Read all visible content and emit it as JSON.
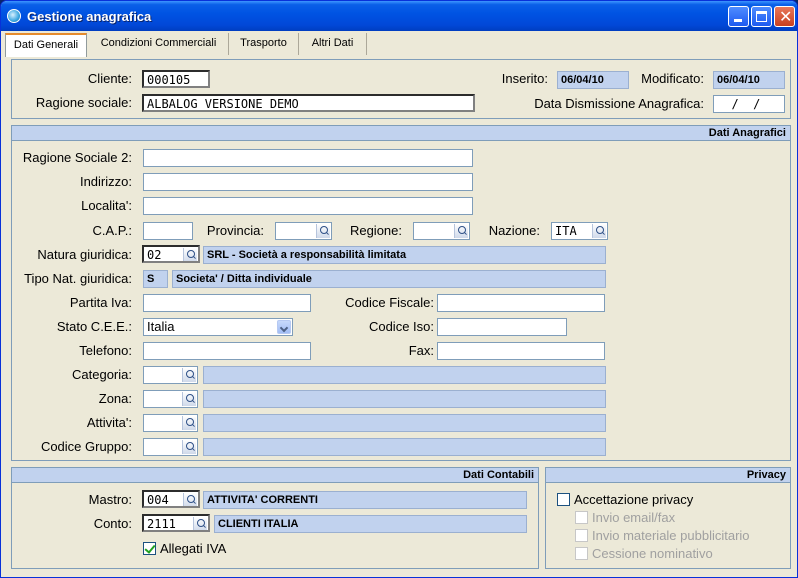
{
  "window": {
    "title": "Gestione anagrafica"
  },
  "tabs": [
    {
      "label": "Dati Generali"
    },
    {
      "label": "Condizioni Commerciali"
    },
    {
      "label": "Trasporto"
    },
    {
      "label": "Altri Dati"
    }
  ],
  "header": {
    "cliente_label": "Cliente:",
    "cliente_value": "000105",
    "ragione_sociale_label": "Ragione sociale:",
    "ragione_sociale_value": "ALBALOG VERSIONE DEMO",
    "inserito_label": "Inserito:",
    "inserito_value": "06/04/10",
    "modificato_label": "Modificato:",
    "modificato_value": "06/04/10",
    "dismissione_label": "Data Dismissione Anagrafica:",
    "dismissione_value": "  /  /"
  },
  "anagrafici": {
    "title": "Dati Anagrafici",
    "ragione_sociale2_label": "Ragione Sociale 2:",
    "indirizzo_label": "Indirizzo:",
    "localita_label": "Localita':",
    "cap_label": "C.A.P.:",
    "provincia_label": "Provincia:",
    "regione_label": "Regione:",
    "nazione_label": "Nazione:",
    "nazione_value": "ITA",
    "natura_label": "Natura giuridica:",
    "natura_code": "02",
    "natura_desc": "SRL - Società a responsabilità limitata",
    "tipo_nat_label": "Tipo Nat. giuridica:",
    "tipo_nat_code": "S",
    "tipo_nat_desc": "Societa' / Ditta individuale",
    "partita_iva_label": "Partita Iva:",
    "codice_fiscale_label": "Codice Fiscale:",
    "stato_cee_label": "Stato C.E.E.:",
    "stato_cee_value": "Italia",
    "codice_iso_label": "Codice Iso:",
    "telefono_label": "Telefono:",
    "fax_label": "Fax:",
    "categoria_label": "Categoria:",
    "zona_label": "Zona:",
    "attivita_label": "Attivita':",
    "codice_gruppo_label": "Codice Gruppo:"
  },
  "contabili": {
    "title": "Dati Contabili",
    "mastro_label": "Mastro:",
    "mastro_code": "004",
    "mastro_desc": "ATTIVITA' CORRENTI",
    "conto_label": "Conto:",
    "conto_code": "2111",
    "conto_desc": "CLIENTI ITALIA",
    "allegati_label": "Allegati IVA"
  },
  "privacy": {
    "title": "Privacy",
    "accettazione_label": "Accettazione privacy",
    "invio_email_label": "Invio email/fax",
    "invio_materiale_label": "Invio materiale pubblicitario",
    "cessione_label": "Cessione nominativo"
  }
}
